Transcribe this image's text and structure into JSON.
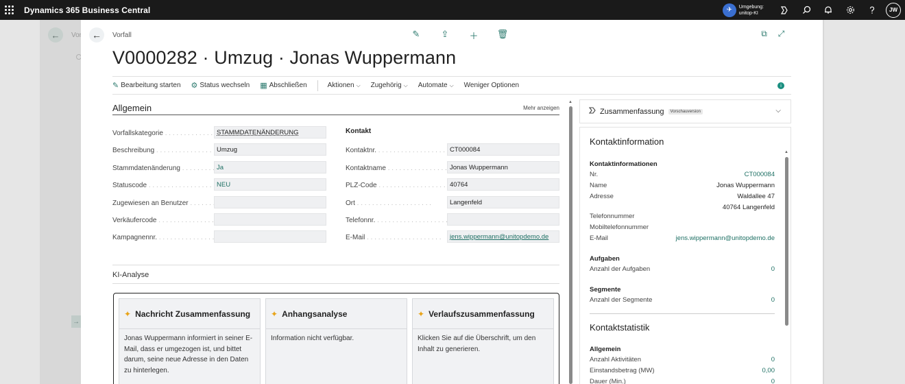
{
  "app": {
    "title": "Dynamics 365 Business Central",
    "environment_label": "Umgebung:",
    "environment_name": "unitop-KI",
    "user_initials": "JW"
  },
  "background": {
    "crumb_fragment": "Vor"
  },
  "header": {
    "crumb": "Vorfall",
    "title": "V0000282 · Umzug · Jonas Wuppermann"
  },
  "actions": {
    "edit": "Bearbeitung starten",
    "status": "Status wechseln",
    "close": "Abschließen",
    "actions_menu": "Aktionen",
    "related": "Zugehörig",
    "automate": "Automate",
    "fewer": "Weniger Optionen"
  },
  "general": {
    "title": "Allgemein",
    "show_more": "Mehr anzeigen",
    "left_fields": [
      {
        "label": "Vorfallskategorie",
        "value": "STAMMDATENÄNDERUNG"
      },
      {
        "label": "Beschreibung",
        "value": "Umzug"
      },
      {
        "label": "Stammdatenänderung",
        "value": "Ja"
      },
      {
        "label": "Statuscode",
        "value": "NEU"
      },
      {
        "label": "Zugewiesen an Benutzer",
        "value": ""
      },
      {
        "label": "Verkäufercode",
        "value": ""
      },
      {
        "label": "Kampagnennr.",
        "value": ""
      }
    ],
    "contact_title": "Kontakt",
    "right_fields": [
      {
        "label": "Kontaktnr.",
        "value": "CT000084"
      },
      {
        "label": "Kontaktname",
        "value": "Jonas Wuppermann"
      },
      {
        "label": "PLZ-Code",
        "value": "40764"
      },
      {
        "label": "Ort",
        "value": "Langenfeld"
      },
      {
        "label": "Telefonnr.",
        "value": ""
      },
      {
        "label": "E-Mail",
        "value": "jens.wippermann@unitopdemo.de"
      }
    ]
  },
  "ki": {
    "title": "KI-Analyse",
    "cards": [
      {
        "title": "Nachricht Zusammenfassung",
        "text": "Jonas Wuppermann informiert in seiner E-Mail, dass er umgezogen ist, und bittet darum, seine neue Adresse in den Daten zu hinterlegen."
      },
      {
        "title": "Anhangsanalyse",
        "text": "Information nicht verfügbar."
      },
      {
        "title": "Verlaufszusammenfassung",
        "text": "Klicken Sie auf die Überschrift, um den Inhalt zu generieren."
      }
    ]
  },
  "summary": {
    "title": "Zusammenfassung",
    "badge": "Vorschauversion"
  },
  "factbox": {
    "contact_info_title": "Kontaktinformation",
    "contact_info_sub": "Kontaktinformationen",
    "nr_label": "Nr.",
    "nr_value": "CT000084",
    "name_label": "Name",
    "name_value": "Jonas Wuppermann",
    "address_label": "Adresse",
    "address_line1": "Waldallee 47",
    "address_line2": "40764 Langenfeld",
    "phone_label": "Telefonnummer",
    "mobile_label": "Mobiltelefonnummer",
    "email_label": "E-Mail",
    "email_value": "jens.wippermann@unitopdemo.de",
    "tasks_sub": "Aufgaben",
    "tasks_label": "Anzahl der Aufgaben",
    "tasks_value": "0",
    "segments_sub": "Segmente",
    "segments_label": "Anzahl der Segmente",
    "segments_value": "0",
    "stats_title": "Kontaktstatistik",
    "stats_sub": "Allgemein",
    "activities_label": "Anzahl Aktivitäten",
    "activities_value": "0",
    "cost_label": "Einstandsbetrag (MW)",
    "cost_value": "0,00",
    "duration_label": "Dauer (Min.)",
    "duration_value": "0"
  }
}
